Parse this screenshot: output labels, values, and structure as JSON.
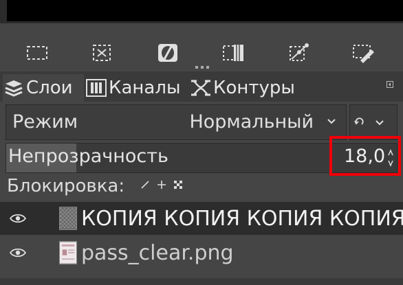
{
  "toolbar": {
    "tools": [
      {
        "icon": "rect-select-icon"
      },
      {
        "icon": "select-none-icon"
      },
      {
        "icon": "invert-selection-icon"
      },
      {
        "icon": "selection-to-channel-icon"
      },
      {
        "icon": "selection-to-path-icon"
      },
      {
        "icon": "stroke-selection-icon"
      }
    ]
  },
  "tabs": [
    {
      "label": "Слои",
      "icon": "layers-icon",
      "active": true
    },
    {
      "label": "Каналы",
      "icon": "channels-icon",
      "active": false
    },
    {
      "label": "Контуры",
      "icon": "paths-icon",
      "active": false
    }
  ],
  "mode": {
    "label": "Режим",
    "value": "Нормальный"
  },
  "opacity": {
    "label": "Непрозрачность",
    "value": "18,0",
    "fill_fraction": 0.18
  },
  "lock": {
    "label": "Блокировка:",
    "icons": [
      "lock-pixels-icon",
      "lock-position-icon",
      "lock-alpha-icon"
    ]
  },
  "layers": [
    {
      "name": "КОПИЯ КОПИЯ КОПИЯ КОПИЯ",
      "visible": true,
      "selected": true
    },
    {
      "name": "pass_clear.png",
      "visible": true,
      "selected": false
    }
  ],
  "colors": {
    "highlight": "#f00008",
    "panel": "#454545",
    "selected_row": "#2c2c2c"
  }
}
